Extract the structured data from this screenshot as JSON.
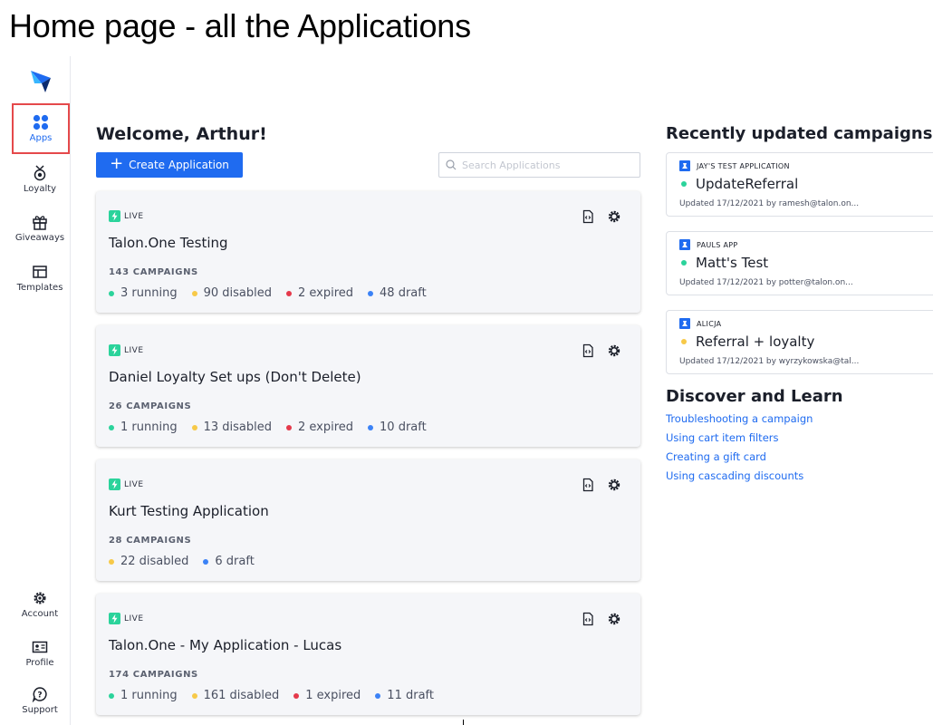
{
  "page_heading": "Home page - all the Applications",
  "sidebar": {
    "top_items": [
      {
        "label": "Apps",
        "icon": "apps-grid-icon",
        "active": true
      },
      {
        "label": "Loyalty",
        "icon": "loyalty-medal-icon"
      },
      {
        "label": "Giveaways",
        "icon": "gift-icon"
      },
      {
        "label": "Templates",
        "icon": "templates-icon"
      }
    ],
    "bottom_items": [
      {
        "label": "Account",
        "icon": "gear-icon"
      },
      {
        "label": "Profile",
        "icon": "id-card-icon"
      },
      {
        "label": "Support",
        "icon": "help-icon"
      }
    ]
  },
  "main": {
    "welcome": "Welcome, Arthur!",
    "create_button": "Create Application",
    "search_placeholder": "Search Applications",
    "applications": [
      {
        "status": "LIVE",
        "name": "Talon.One Testing",
        "campaigns": "143 CAMPAIGNS",
        "stats": [
          {
            "label": "3 running",
            "color": "#2bd39b"
          },
          {
            "label": "90 disabled",
            "color": "#f7c948"
          },
          {
            "label": "2 expired",
            "color": "#e5394b"
          },
          {
            "label": "48 draft",
            "color": "#3b82f6"
          }
        ]
      },
      {
        "status": "LIVE",
        "name": "Daniel Loyalty Set ups (Don't Delete)",
        "campaigns": "26 CAMPAIGNS",
        "stats": [
          {
            "label": "1 running",
            "color": "#2bd39b"
          },
          {
            "label": "13 disabled",
            "color": "#f7c948"
          },
          {
            "label": "2 expired",
            "color": "#e5394b"
          },
          {
            "label": "10 draft",
            "color": "#3b82f6"
          }
        ]
      },
      {
        "status": "LIVE",
        "name": "Kurt Testing Application",
        "campaigns": "28 CAMPAIGNS",
        "stats": [
          {
            "label": "22 disabled",
            "color": "#f7c948"
          },
          {
            "label": "6 draft",
            "color": "#3b82f6"
          }
        ]
      },
      {
        "status": "LIVE",
        "name": "Talon.One - My Application - Lucas",
        "campaigns": "174 CAMPAIGNS",
        "stats": [
          {
            "label": "1 running",
            "color": "#2bd39b"
          },
          {
            "label": "161 disabled",
            "color": "#f7c948"
          },
          {
            "label": "1 expired",
            "color": "#e5394b"
          },
          {
            "label": "11 draft",
            "color": "#3b82f6"
          }
        ]
      }
    ]
  },
  "recent": {
    "title": "Recently updated campaigns",
    "campaigns": [
      {
        "app": "JAY'S TEST APPLICATION",
        "name": "UpdateReferral",
        "status_color": "#2bd39b",
        "updated": "Updated 17/12/2021 by ramesh@talon.on..."
      },
      {
        "app": "PAULS APP",
        "name": "Matt's Test",
        "status_color": "#2bd39b",
        "updated": "Updated 17/12/2021 by potter@talon.on..."
      },
      {
        "app": "ALICJA",
        "name": "Referral + loyalty",
        "status_color": "#f7c948",
        "updated": "Updated 17/12/2021 by wyrzykowska@tal..."
      }
    ]
  },
  "discover": {
    "title": "Discover and Learn",
    "links": [
      "Troubleshooting a campaign",
      "Using cart item filters",
      "Creating a gift card",
      "Using cascading discounts"
    ]
  }
}
